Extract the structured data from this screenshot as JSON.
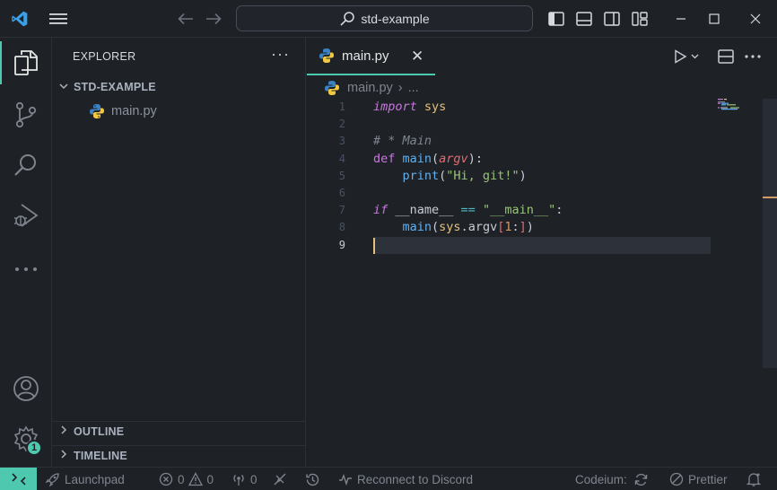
{
  "titlebar": {
    "search_text": "std-example",
    "icons": [
      "vscode-logo",
      "menu-icon",
      "back-arrow-icon",
      "forward-arrow-icon",
      "search-icon",
      "toggle-primary-sidebar-icon",
      "toggle-panel-icon",
      "toggle-secondary-sidebar-icon",
      "customize-layout-icon",
      "minimize-icon",
      "maximize-icon",
      "close-icon"
    ]
  },
  "activitybar": {
    "items": [
      "explorer-icon",
      "source-control-icon",
      "search-icon",
      "run-debug-icon",
      "more-icon"
    ],
    "bottom": [
      "account-icon",
      "settings-gear-icon"
    ],
    "settings_badge": "1",
    "accent": "#4ec9b0"
  },
  "sidebar": {
    "title": "EXPLORER",
    "more": "···",
    "folder": "STD-EXAMPLE",
    "files": [
      {
        "name": "main.py"
      }
    ],
    "outline": "OUTLINE",
    "timeline": "TIMELINE"
  },
  "editor": {
    "tab_label": "main.py",
    "tab_close": "✕",
    "breadcrumb_file": "main.py",
    "breadcrumb_sep": "›",
    "breadcrumb_more": "...",
    "line_numbers": [
      "1",
      "2",
      "3",
      "4",
      "5",
      "6",
      "7",
      "8",
      "9"
    ],
    "current_line": 9,
    "code": {
      "l1": {
        "kw": "import",
        "mod": " sys"
      },
      "l3": {
        "comment": "# * Main"
      },
      "l4": {
        "kw": "def",
        "fn": " main",
        "p1": "(",
        "param": "argv",
        "p2": "):"
      },
      "l5": {
        "indent": "    ",
        "fn": "print",
        "p1": "(",
        "str": "\"Hi, git!\"",
        "p2": ")"
      },
      "l7": {
        "kw": "if",
        "name": " __name__ ",
        "op": "==",
        "sp": " ",
        "str": "\"__main__\"",
        "colon": ":"
      },
      "l8": {
        "indent": "    ",
        "fn": "main",
        "p1": "(",
        "obj": "sys",
        "dot": ".",
        "attr": "argv",
        "b1": "[",
        "num": "1",
        "colon": ":",
        "b2": "]",
        "p2": ")"
      }
    },
    "actions": [
      "run-icon",
      "split-editor-icon",
      "more-actions-icon"
    ]
  },
  "statusbar": {
    "launchpad": "Launchpad",
    "errors": "0",
    "warnings": "0",
    "ports": "0",
    "discord": "Reconnect to Discord",
    "codeium": "Codeium:",
    "prettier": "Prettier",
    "remote_color": "#4ec9b0"
  }
}
